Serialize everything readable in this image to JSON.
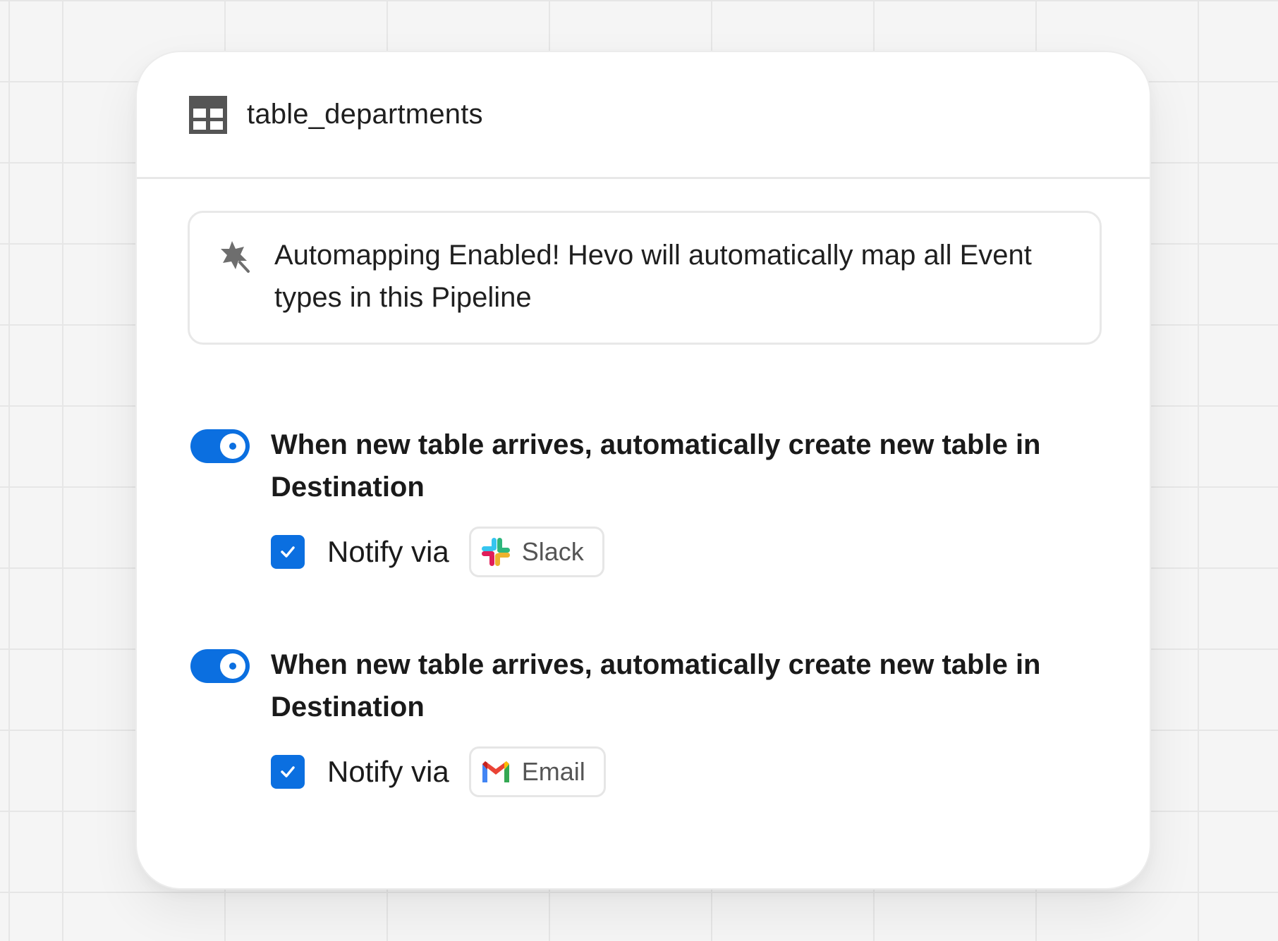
{
  "card": {
    "title": "table_departments",
    "title_icon": "table-grid-icon"
  },
  "banner": {
    "icon": "magic-wand-icon",
    "text": "Automapping Enabled! Hevo will automatically map all Event types in this Pipeline"
  },
  "rules": [
    {
      "enabled": true,
      "text": "When new table arrives, automatically create new table in Destination",
      "notify_checked": true,
      "notify_label": "Notify via",
      "channel": {
        "name": "Slack",
        "icon": "slack-logo-icon"
      }
    },
    {
      "enabled": true,
      "text": "When new table arrives, automatically create new table in Destination",
      "notify_checked": true,
      "notify_label": "Notify via",
      "channel": {
        "name": "Email",
        "icon": "gmail-logo-icon"
      }
    }
  ],
  "colors": {
    "accent": "#0b6fe0",
    "background": "#f5f5f5",
    "card": "#ffffff",
    "border": "#e8e8e8"
  }
}
